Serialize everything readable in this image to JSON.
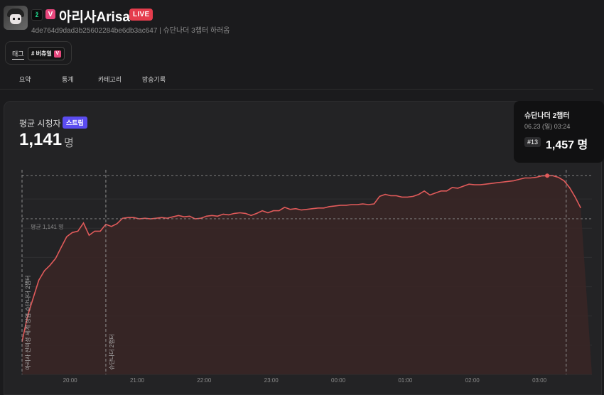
{
  "channel": {
    "name": "아리사Arisa",
    "live_label": "LIVE",
    "v_badge": "V",
    "subline": "4de764d9dad3b25602284be6db3ac647 | 슈단나더 3챕터 하러옴"
  },
  "tags": {
    "label": "태그",
    "chip_text": "# 버츄얼",
    "chip_badge": "V"
  },
  "tabs": [
    "요약",
    "통계",
    "카테고리",
    "방송기록"
  ],
  "stats": {
    "avg_label": "평균 시청자",
    "stream_badge": "스트림",
    "avg_value": "1,141",
    "unit": "명"
  },
  "tooltip": {
    "title": "슈단나더 2챕터",
    "date": "06.23 (일) 03:24",
    "rank": "#13",
    "value": "1,457 명"
  },
  "colors": {
    "line": "#e05a5a",
    "fill": "#3a2626",
    "accent_badge": "#5b4cf0",
    "live": "#e53d4d"
  },
  "chart_data": {
    "type": "area",
    "x": [
      "19:17",
      "19:22",
      "19:27",
      "19:32",
      "19:37",
      "19:42",
      "19:47",
      "19:52",
      "19:57",
      "20:02",
      "20:07",
      "20:12",
      "20:17",
      "20:22",
      "20:27",
      "20:32",
      "20:37",
      "20:42",
      "20:47",
      "20:52",
      "20:57",
      "21:02",
      "21:07",
      "21:12",
      "21:17",
      "21:22",
      "21:27",
      "21:32",
      "21:37",
      "21:42",
      "21:47",
      "21:52",
      "21:57",
      "22:02",
      "22:07",
      "22:12",
      "22:17",
      "22:22",
      "22:27",
      "22:32",
      "22:37",
      "22:42",
      "22:47",
      "22:52",
      "22:57",
      "23:02",
      "23:07",
      "23:12",
      "23:17",
      "23:22",
      "23:27",
      "23:32",
      "23:37",
      "23:42",
      "23:47",
      "23:52",
      "23:57",
      "00:02",
      "00:07",
      "00:12",
      "00:17",
      "00:22",
      "00:27",
      "00:32",
      "00:37",
      "00:42",
      "00:47",
      "00:52",
      "00:57",
      "01:02",
      "01:07",
      "01:12",
      "01:17",
      "01:22",
      "01:27",
      "01:32",
      "01:37",
      "01:42",
      "01:47",
      "01:52",
      "01:57",
      "02:02",
      "02:07",
      "02:12",
      "02:17",
      "02:22",
      "02:27",
      "02:32",
      "02:37",
      "02:42",
      "02:47",
      "02:52",
      "02:57",
      "03:02",
      "03:07",
      "03:12",
      "03:17",
      "03:22",
      "03:27",
      "03:32",
      "03:37",
      "03:42",
      "03:47"
    ],
    "values": [
      240,
      430,
      560,
      690,
      760,
      800,
      850,
      930,
      1010,
      1040,
      1050,
      1110,
      1020,
      1050,
      1050,
      1100,
      1085,
      1105,
      1145,
      1150,
      1150,
      1140,
      1145,
      1140,
      1145,
      1150,
      1145,
      1155,
      1165,
      1155,
      1160,
      1140,
      1145,
      1160,
      1165,
      1160,
      1175,
      1170,
      1180,
      1185,
      1180,
      1165,
      1180,
      1200,
      1185,
      1200,
      1200,
      1225,
      1210,
      1215,
      1205,
      1210,
      1215,
      1220,
      1220,
      1230,
      1235,
      1240,
      1240,
      1245,
      1245,
      1250,
      1245,
      1250,
      1305,
      1320,
      1310,
      1310,
      1300,
      1300,
      1305,
      1320,
      1345,
      1315,
      1330,
      1345,
      1345,
      1370,
      1365,
      1380,
      1395,
      1390,
      1390,
      1395,
      1400,
      1405,
      1410,
      1415,
      1420,
      1430,
      1440,
      1440,
      1445,
      1455,
      1457,
      1457,
      1445,
      1420,
      1370,
      1300,
      1220
    ],
    "xlim": [
      "19:17",
      "03:47"
    ],
    "ylim": [
      0,
      1500
    ],
    "tick_labels": [
      "20:00",
      "21:00",
      "22:00",
      "23:00",
      "00:00",
      "01:00",
      "02:00",
      "03:00"
    ],
    "reference_line": {
      "value": 1141,
      "label": "평균 1,141 명"
    },
    "markers": [
      {
        "x": "19:17",
        "label": "아리사 신의성 세계 상업 슈단나더 2챕터"
      },
      {
        "x": "20:32",
        "label": "슈단나더 2챕터"
      },
      {
        "x": "03:24",
        "label": ""
      }
    ],
    "grid": true
  }
}
